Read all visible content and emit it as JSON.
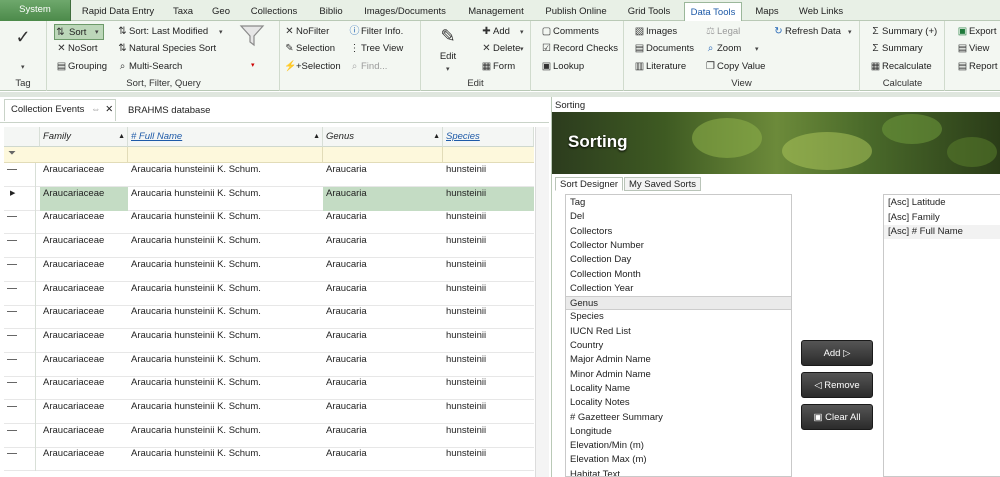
{
  "tabs": [
    "System",
    "Rapid Data Entry",
    "Taxa",
    "Geo",
    "Collections",
    "Biblio",
    "Images/Documents",
    "Management",
    "Publish Online",
    "Grid Tools",
    "Data Tools",
    "Maps",
    "Web Links"
  ],
  "active_tab": "Data Tools",
  "ribbon": {
    "tag": {
      "label": "Tag"
    },
    "sort_group": {
      "label": "Sort, Filter, Query",
      "sort": "Sort",
      "sort_last": "Sort: Last Modified",
      "nosort": "NoSort",
      "natural_sort": "Natural Species Sort",
      "grouping": "Grouping",
      "multi_search": "Multi-Search",
      "nofilter": "NoFilter",
      "filter_info": "Filter Info.",
      "selection": "Selection",
      "tree_view": "Tree View",
      "plus_selection": "+Selection",
      "find": "Find..."
    },
    "edit_group": {
      "label": "Edit",
      "edit": "Edit",
      "add": "Add",
      "delete": "Delete",
      "form": "Form",
      "comments": "Comments",
      "record_checks": "Record Checks",
      "lookup": "Lookup"
    },
    "view_group": {
      "label": "View",
      "images": "Images",
      "documents": "Documents",
      "literature": "Literature",
      "legal": "Legal",
      "zoom": "Zoom",
      "copy_value": "Copy Value",
      "refresh": "Refresh Data"
    },
    "calc_group": {
      "label": "Calculate",
      "summary_plus": "Summary (+)",
      "summary": "Summary",
      "recalculate": "Recalculate"
    },
    "export_group": {
      "export": "Export",
      "view": "View",
      "report": "Report"
    }
  },
  "left_tabs": {
    "tab1": "Collection Events",
    "tab2": "BRAHMS database"
  },
  "grid": {
    "columns": [
      "Family",
      "# Full Name",
      "Genus",
      "Species"
    ],
    "rows": [
      [
        "Araucariaceae",
        "Araucaria hunsteinii K. Schum.",
        "Araucaria",
        "hunsteinii"
      ],
      [
        "Araucariaceae",
        "Araucaria hunsteinii K. Schum.",
        "Araucaria",
        "hunsteinii"
      ],
      [
        "Araucariaceae",
        "Araucaria hunsteinii K. Schum.",
        "Araucaria",
        "hunsteinii"
      ],
      [
        "Araucariaceae",
        "Araucaria hunsteinii K. Schum.",
        "Araucaria",
        "hunsteinii"
      ],
      [
        "Araucariaceae",
        "Araucaria hunsteinii K. Schum.",
        "Araucaria",
        "hunsteinii"
      ],
      [
        "Araucariaceae",
        "Araucaria hunsteinii K. Schum.",
        "Araucaria",
        "hunsteinii"
      ],
      [
        "Araucariaceae",
        "Araucaria hunsteinii K. Schum.",
        "Araucaria",
        "hunsteinii"
      ],
      [
        "Araucariaceae",
        "Araucaria hunsteinii K. Schum.",
        "Araucaria",
        "hunsteinii"
      ],
      [
        "Araucariaceae",
        "Araucaria hunsteinii K. Schum.",
        "Araucaria",
        "hunsteinii"
      ],
      [
        "Araucariaceae",
        "Araucaria hunsteinii K. Schum.",
        "Araucaria",
        "hunsteinii"
      ],
      [
        "Araucariaceae",
        "Araucaria hunsteinii K. Schum.",
        "Araucaria",
        "hunsteinii"
      ],
      [
        "Araucariaceae",
        "Araucaria hunsteinii K. Schum.",
        "Araucaria",
        "hunsteinii"
      ],
      [
        "Araucariaceae",
        "Araucaria hunsteinii K. Schum.",
        "Araucaria",
        "hunsteinii"
      ]
    ]
  },
  "sorting": {
    "title": "Sorting",
    "banner_title": "Sorting",
    "tab_designer": "Sort Designer",
    "tab_saved": "My Saved Sorts",
    "fields": [
      "Tag",
      "Del",
      "Collectors",
      "Collector Number",
      "Collection Day",
      "Collection Month",
      "Collection Year",
      "Genus",
      "Species",
      "IUCN Red List",
      "Country",
      "Major Admin Name",
      "Minor Admin Name",
      "Locality Name",
      "Locality Notes",
      "# Gazetteer Summary",
      "Longitude",
      "Elevation/Min (m)",
      "Elevation Max (m)",
      "Habitat Text"
    ],
    "selected_field": "Genus",
    "add": "Add",
    "remove": "Remove",
    "clear_all": "Clear All",
    "sort_items": [
      "[Asc]  Latitude",
      "[Asc]  Family",
      "[Asc]  # Full Name"
    ]
  }
}
